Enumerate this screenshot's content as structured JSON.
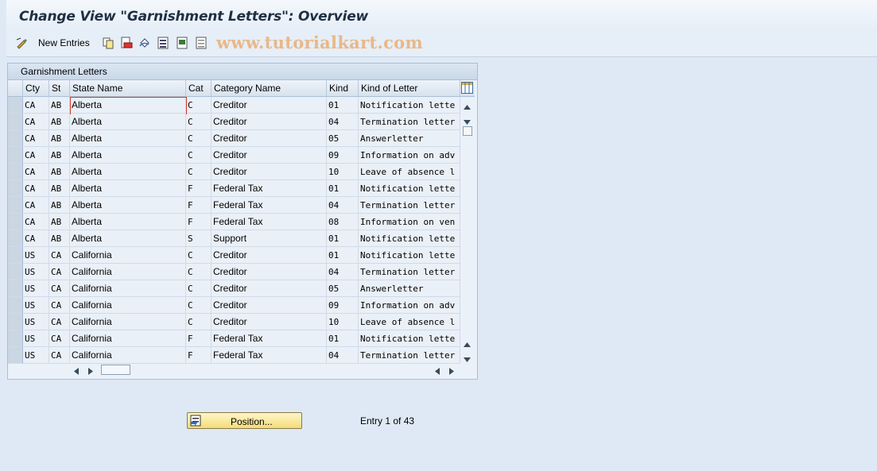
{
  "window": {
    "title": "Change View \"Garnishment Letters\": Overview"
  },
  "toolbar": {
    "new_entries_label": "New Entries",
    "icons": [
      "display-change-icon",
      "copy-icon",
      "delete-icon",
      "undo-icon",
      "select-all-icon",
      "select-block-icon",
      "deselect-all-icon"
    ]
  },
  "watermark": "www.tutorialkart.com",
  "panel": {
    "title": "Garnishment Letters"
  },
  "table": {
    "columns": [
      "Cty",
      "St",
      "State Name",
      "Cat",
      "Category Name",
      "Kind",
      "Kind of Letter"
    ],
    "rows": [
      [
        "CA",
        "AB",
        "Alberta",
        "C",
        "Creditor",
        "01",
        "Notification lette"
      ],
      [
        "CA",
        "AB",
        "Alberta",
        "C",
        "Creditor",
        "04",
        "Termination letter"
      ],
      [
        "CA",
        "AB",
        "Alberta",
        "C",
        "Creditor",
        "05",
        "Answerletter"
      ],
      [
        "CA",
        "AB",
        "Alberta",
        "C",
        "Creditor",
        "09",
        "Information on adv"
      ],
      [
        "CA",
        "AB",
        "Alberta",
        "C",
        "Creditor",
        "10",
        "Leave of absence l"
      ],
      [
        "CA",
        "AB",
        "Alberta",
        "F",
        "Federal Tax",
        "01",
        "Notification lette"
      ],
      [
        "CA",
        "AB",
        "Alberta",
        "F",
        "Federal Tax",
        "04",
        "Termination letter"
      ],
      [
        "CA",
        "AB",
        "Alberta",
        "F",
        "Federal Tax",
        "08",
        "Information on ven"
      ],
      [
        "CA",
        "AB",
        "Alberta",
        "S",
        "Support",
        "01",
        "Notification lette"
      ],
      [
        "US",
        "CA",
        "California",
        "C",
        "Creditor",
        "01",
        "Notification lette"
      ],
      [
        "US",
        "CA",
        "California",
        "C",
        "Creditor",
        "04",
        "Termination letter"
      ],
      [
        "US",
        "CA",
        "California",
        "C",
        "Creditor",
        "05",
        "Answerletter"
      ],
      [
        "US",
        "CA",
        "California",
        "C",
        "Creditor",
        "09",
        "Information on adv"
      ],
      [
        "US",
        "CA",
        "California",
        "C",
        "Creditor",
        "10",
        "Leave of absence l"
      ],
      [
        "US",
        "CA",
        "California",
        "F",
        "Federal Tax",
        "01",
        "Notification lette"
      ],
      [
        "US",
        "CA",
        "California",
        "F",
        "Federal Tax",
        "04",
        "Termination letter"
      ]
    ]
  },
  "footer": {
    "position_button_label": "Position...",
    "entry_text": "Entry 1 of 43"
  }
}
